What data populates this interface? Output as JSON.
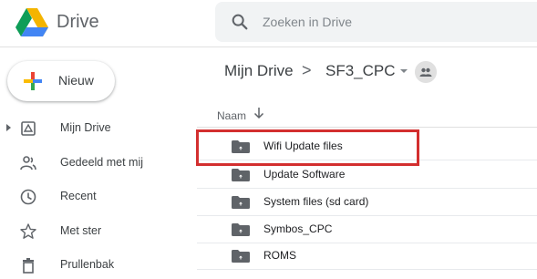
{
  "app": {
    "name": "Drive",
    "logo_icon": "google-drive-logo-icon"
  },
  "search": {
    "placeholder": "Zoeken in Drive",
    "value": "",
    "icon": "search-icon"
  },
  "new_button": {
    "label": "Nieuw",
    "icon": "plus-icon"
  },
  "sidebar": {
    "items": [
      {
        "label": "Mijn Drive",
        "icon": "my-drive-icon",
        "expandable": true
      },
      {
        "label": "Gedeeld met mij",
        "icon": "shared-with-me-icon"
      },
      {
        "label": "Recent",
        "icon": "clock-icon"
      },
      {
        "label": "Met ster",
        "icon": "star-icon"
      },
      {
        "label": "Prullenbak",
        "icon": "trash-icon"
      }
    ]
  },
  "breadcrumb": {
    "root": "Mijn Drive",
    "separator": ">",
    "current": "SF3_CPC",
    "shared_icon": "shared-folder-people-icon"
  },
  "list": {
    "column_header": "Naam",
    "sort_icon": "arrow-down-icon",
    "rows": [
      {
        "name": "Wifi Update files",
        "icon": "folder-icon",
        "highlighted": true
      },
      {
        "name": "Update Software",
        "icon": "folder-icon"
      },
      {
        "name": "System files (sd card)",
        "icon": "folder-icon"
      },
      {
        "name": "Symbos_CPC",
        "icon": "folder-icon"
      },
      {
        "name": "ROMS",
        "icon": "folder-icon"
      }
    ]
  },
  "colors": {
    "highlight_border": "#d32f2f",
    "folder": "#5f6368",
    "drive_green": "#0f9d58",
    "drive_yellow": "#f4b400",
    "drive_blue": "#4285f4",
    "plus_red": "#ea4335"
  }
}
